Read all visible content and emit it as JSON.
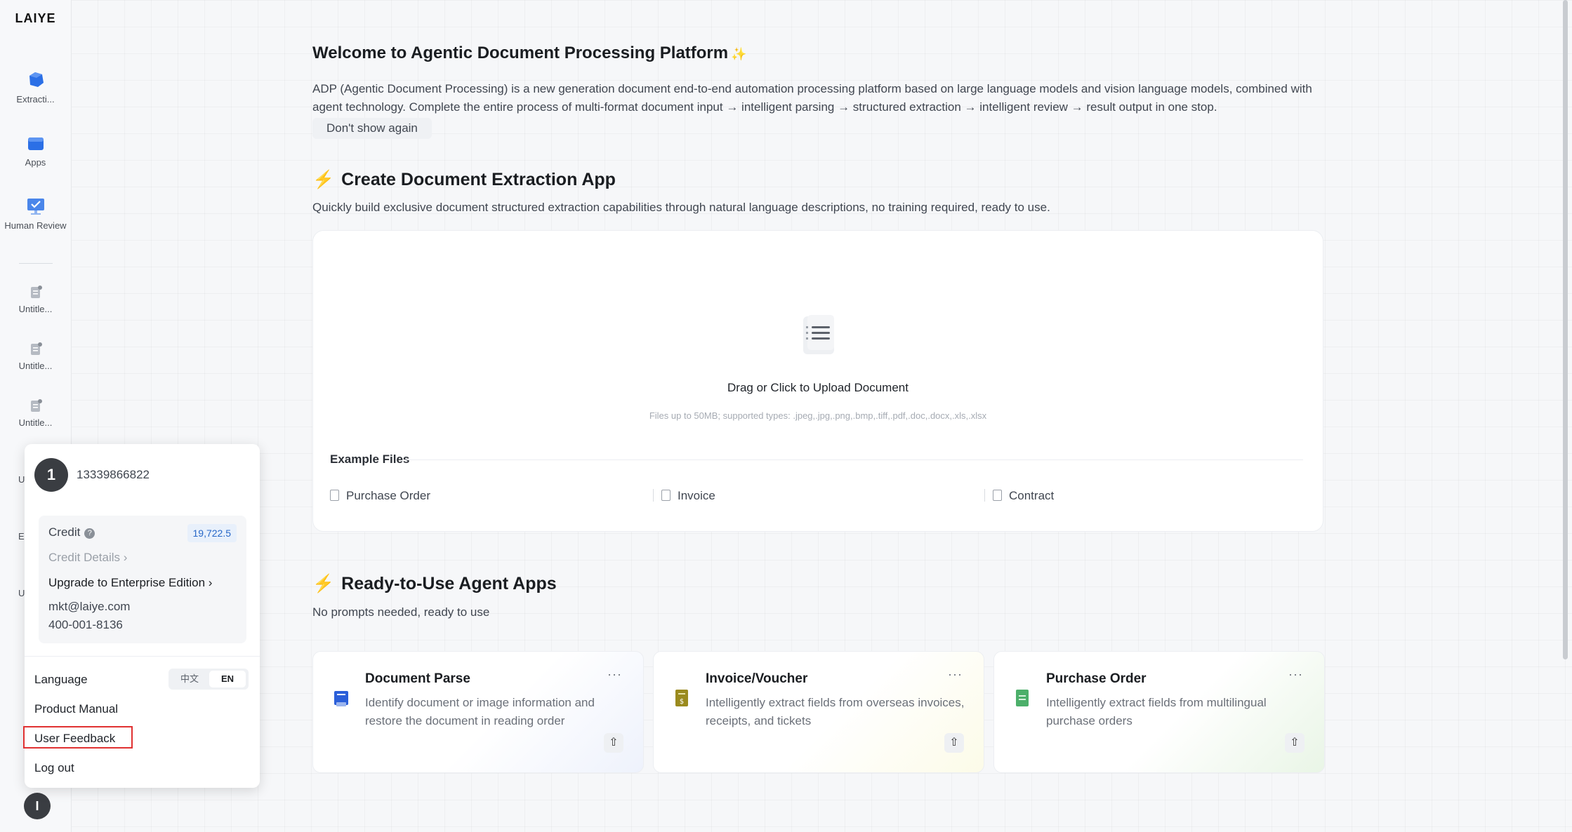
{
  "sidebar": {
    "logo": "LAIYE",
    "items": [
      {
        "label": "Extracti...",
        "icon": "extraction-icon"
      },
      {
        "label": "Apps",
        "icon": "apps-icon"
      },
      {
        "label": "Human Review",
        "icon": "human-review-icon"
      },
      {
        "label": "Untitle...",
        "icon": "document-icon"
      },
      {
        "label": "Untitle...",
        "icon": "document-icon"
      },
      {
        "label": "Untitle...",
        "icon": "document-icon"
      }
    ],
    "peek_items": [
      "U",
      "E",
      "U"
    ],
    "bottom_avatar": "I"
  },
  "welcome": {
    "title": "Welcome to Agentic Document Processing Platform",
    "description": "ADP (Agentic Document Processing) is a new generation document end-to-end automation processing platform based on large language models and vision language models, combined with agent technology. Complete the entire process of multi-format document input → intelligent parsing → structured extraction → intelligent review → result output in one stop.",
    "dont_show": "Don't show again"
  },
  "create_section": {
    "title": "Create Document Extraction App",
    "subtitle": "Quickly build exclusive document structured extraction capabilities through natural language descriptions, no training required, ready to use.",
    "upload_text": "Drag or Click to Upload Document",
    "upload_hint": "Files up to 50MB; supported types: .jpeg,.jpg,.png,.bmp,.tiff,.pdf,.doc,.docx,.xls,.xlsx",
    "example_label": "Example Files",
    "examples": [
      "Purchase Order",
      "Invoice",
      "Contract"
    ]
  },
  "apps_section": {
    "title": "Ready-to-Use Agent Apps",
    "subtitle": "No prompts needed, ready to use",
    "apps": [
      {
        "title": "Document Parse",
        "desc": "Identify document or image information and restore the document in reading order",
        "icon": "document-parse-icon",
        "color": "#2b5fd9"
      },
      {
        "title": "Invoice/Voucher",
        "desc": "Intelligently extract fields from overseas invoices, receipts, and tickets",
        "icon": "invoice-icon",
        "color": "#9a8a1e"
      },
      {
        "title": "Purchase Order",
        "desc": "Intelligently extract fields from multilingual purchase orders",
        "icon": "purchase-order-icon",
        "color": "#4caf6a"
      }
    ],
    "more": "···"
  },
  "user_popup": {
    "avatar": "1",
    "phone": "13339866822",
    "credit_label": "Credit",
    "credit_value": "19,722.5",
    "credit_details": "Credit Details",
    "upgrade": "Upgrade to Enterprise Edition",
    "email": "mkt@laiye.com",
    "tel": "400-001-8136",
    "language_label": "Language",
    "lang_zh": "中文",
    "lang_en": "EN",
    "product_manual": "Product Manual",
    "user_feedback": "User Feedback",
    "logout": "Log out"
  }
}
